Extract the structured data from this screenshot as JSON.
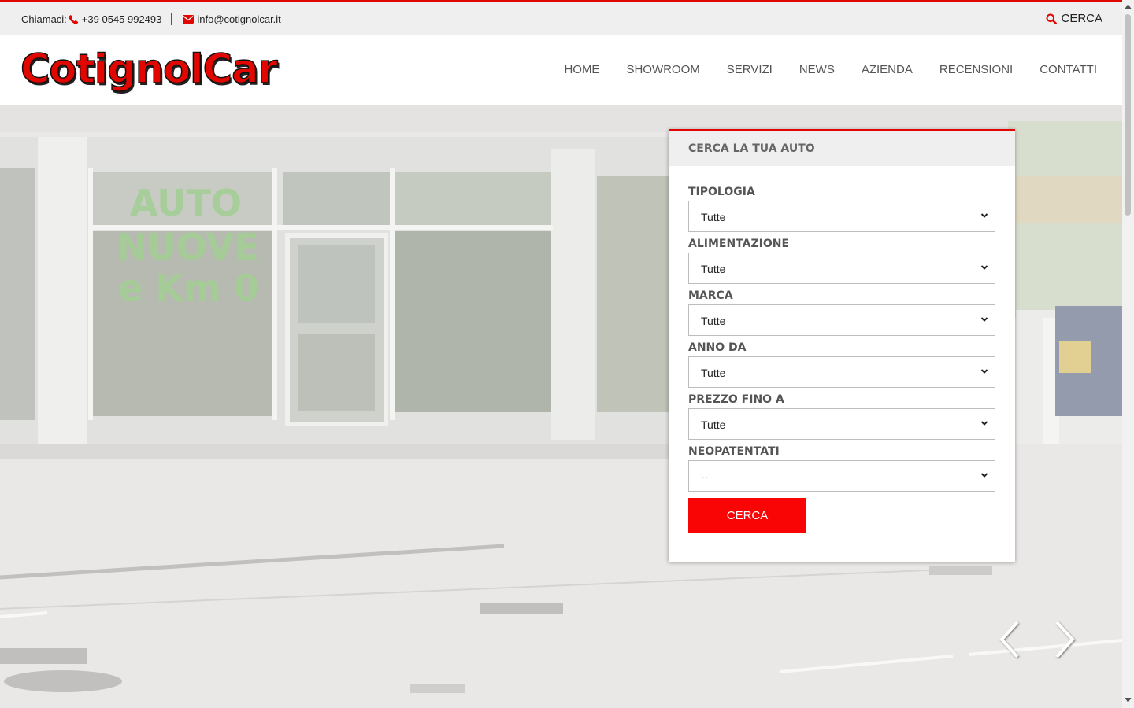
{
  "topbar": {
    "call_label": "Chiamaci:",
    "phone": "+39 0545 992493",
    "email": "info@cotignolcar.it",
    "search_label": "CERCA"
  },
  "header": {
    "logo_text": "CotignolCar",
    "nav": [
      "HOME",
      "SHOWROOM",
      "SERVIZI",
      "NEWS",
      "AZIENDA",
      "RECENSIONI",
      "CONTATTI"
    ]
  },
  "hero": {
    "window_text": [
      "AUTO",
      "NUOVE",
      "e Km 0"
    ]
  },
  "search_panel": {
    "title": "CERCA LA TUA AUTO",
    "fields": [
      {
        "label": "TIPOLOGIA",
        "value": "Tutte"
      },
      {
        "label": "ALIMENTAZIONE",
        "value": "Tutte"
      },
      {
        "label": "MARCA",
        "value": "Tutte"
      },
      {
        "label": "ANNO DA",
        "value": "Tutte"
      },
      {
        "label": "PREZZO FINO A",
        "value": "Tutte"
      },
      {
        "label": "NEOPATENTATI",
        "value": "--"
      }
    ],
    "submit_label": "CERCA"
  },
  "colors": {
    "accent": "#e10600",
    "button": "#fa0505",
    "topbar_bg": "#efefef"
  },
  "icons": {
    "phone": "phone-icon",
    "email": "envelope-icon",
    "search": "search-icon",
    "prev": "chevron-left-icon",
    "next": "chevron-right-icon"
  }
}
